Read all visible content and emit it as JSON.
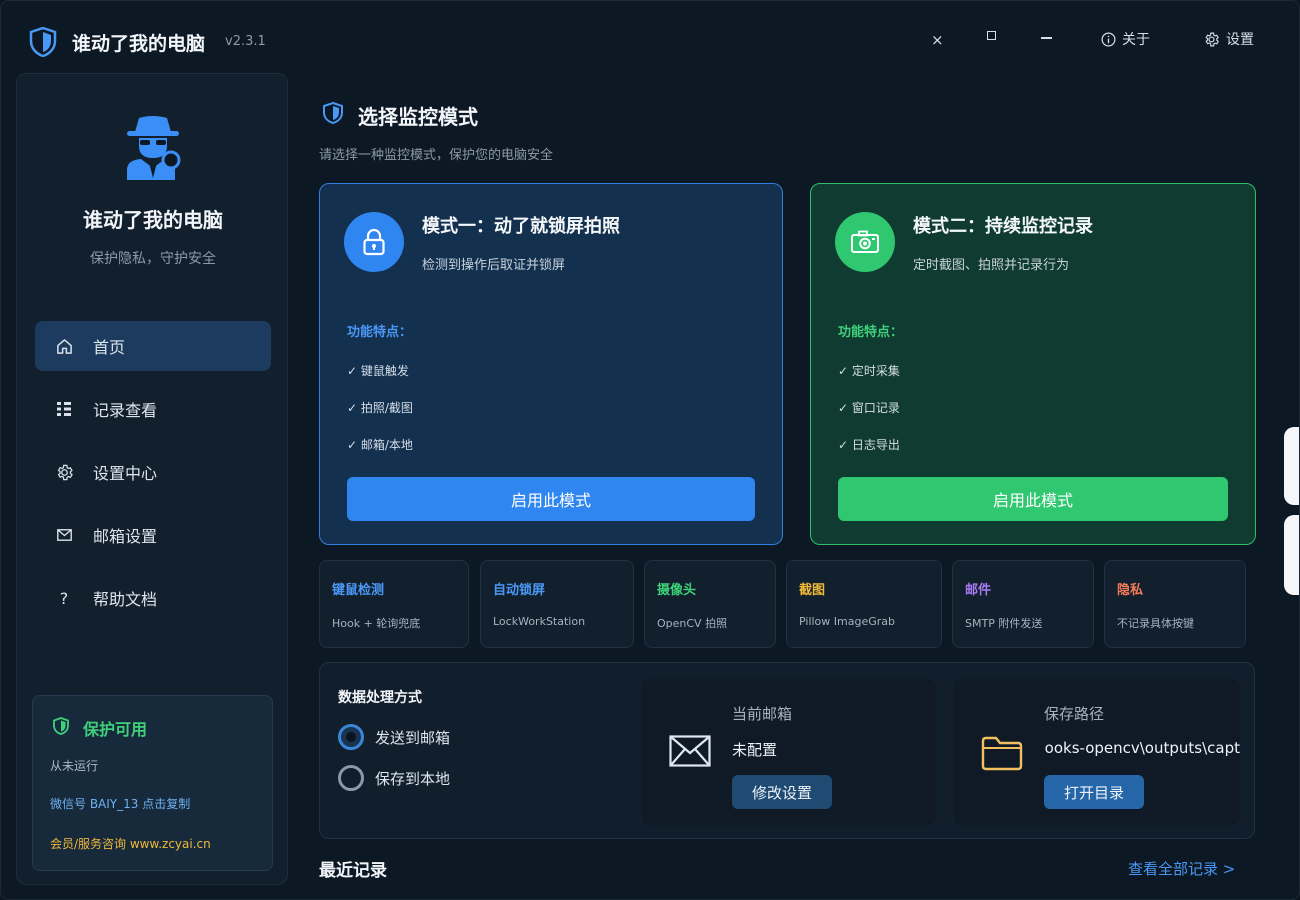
{
  "app": {
    "title": "谁动了我的电脑",
    "version": "v2.3.1"
  },
  "titlebar": {
    "close_glyph": "×",
    "about_label": "关于",
    "settings_label": "设置"
  },
  "sidebar": {
    "title": "谁动了我的电脑",
    "subtitle": "保护隐私，守护安全",
    "items": [
      {
        "label": "首页",
        "icon": "home-icon",
        "active": true
      },
      {
        "label": "记录查看",
        "icon": "list-icon",
        "active": false
      },
      {
        "label": "设置中心",
        "icon": "gear-icon",
        "active": false
      },
      {
        "label": "邮箱设置",
        "icon": "mail-icon",
        "active": false
      },
      {
        "label": "帮助文档",
        "icon": "help-icon",
        "active": false
      }
    ],
    "status": {
      "title": "保护可用",
      "run_status": "从未运行",
      "wechat": "微信号 BAIY_13  点击复制",
      "service": "会员/服务咨询 www.zcyai.cn"
    }
  },
  "main": {
    "title": "选择监控模式",
    "subtitle": "请选择一种监控模式，保护您的电脑安全",
    "modes": [
      {
        "name": "模式一：动了就锁屏拍照",
        "desc": "检测到操作后取证并锁屏",
        "features_label": "功能特点：",
        "features": [
          "✓  键鼠触发",
          "✓  拍照/截图",
          "✓  邮箱/本地"
        ],
        "button": "启用此模式",
        "color": "#2f86f0"
      },
      {
        "name": "模式二：持续监控记录",
        "desc": "定时截图、拍照并记录行为",
        "features_label": "功能特点：",
        "features": [
          "✓  定时采集",
          "✓  窗口记录",
          "✓  日志导出"
        ],
        "button": "启用此模式",
        "color": "#2fc76f"
      }
    ],
    "tags": [
      {
        "name": "键鼠检测",
        "desc": "Hook + 轮询兜底",
        "color": "#4a98f5"
      },
      {
        "name": "自动锁屏",
        "desc": "LockWorkStation",
        "color": "#4a98f5"
      },
      {
        "name": "摄像头",
        "desc": "OpenCV 拍照",
        "color": "#3fd07a"
      },
      {
        "name": "截图",
        "desc": "Pillow ImageGrab",
        "color": "#f0b93a"
      },
      {
        "name": "邮件",
        "desc": "SMTP 附件发送",
        "color": "#a77bf3"
      },
      {
        "name": "隐私",
        "desc": "不记录具体按键",
        "color": "#f07a5a"
      }
    ],
    "data_handling": {
      "title": "数据处理方式",
      "options": [
        "发送到邮箱",
        "保存到本地"
      ],
      "selected": "发送到邮箱",
      "email": {
        "label": "当前邮箱",
        "value": "未配置",
        "button": "修改设置"
      },
      "path": {
        "label": "保存路径",
        "value": "hooks-opencv\\outputs\\capt",
        "button": "打开目录"
      }
    },
    "recent": {
      "title": "最近记录",
      "link": "查看全部记录 >"
    }
  }
}
